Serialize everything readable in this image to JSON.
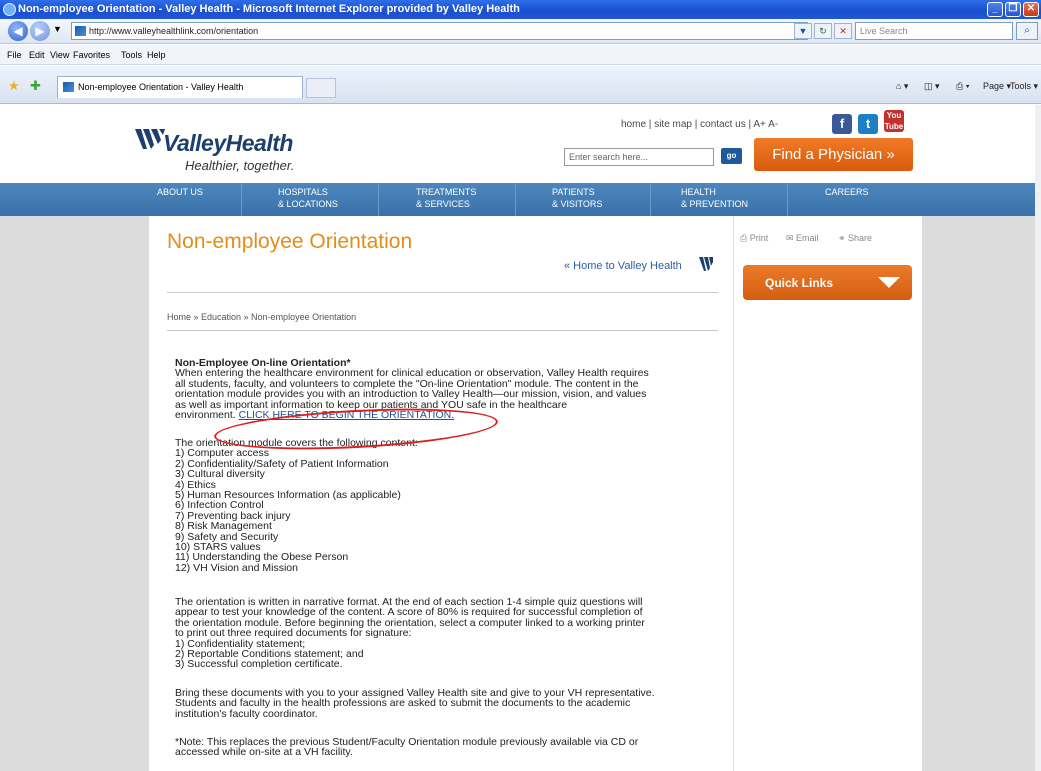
{
  "window": {
    "title": "Non-employee Orientation - Valley Health - Microsoft Internet Explorer provided by Valley Health",
    "address": "http://www.valleyhealthlink.com/orientation",
    "search_placeholder": "Live Search",
    "menu": [
      "File",
      "Edit",
      "View",
      "Favorites",
      "Tools",
      "Help"
    ],
    "tab_title": "Non-employee Orientation - Valley Health",
    "commands": [
      "Page ▾",
      "Tools ▾"
    ]
  },
  "site": {
    "logo_name": "ValleyHealth",
    "logo_tagline": "Healthier, together.",
    "top_links": [
      "home",
      "site map",
      "contact us",
      "A+",
      "A-"
    ],
    "social": [
      "facebook-icon",
      "twitter-icon",
      "youtube-icon"
    ],
    "search_placeholder": "Enter search here...",
    "go_label": "go",
    "find_physician": "Find a Physician »",
    "nav": [
      {
        "line1": "ABOUT US",
        "line2": ""
      },
      {
        "line1": "HOSPITALS",
        "line2": "& LOCATIONS"
      },
      {
        "line1": "TREATMENTS",
        "line2": "& SERVICES"
      },
      {
        "line1": "PATIENTS",
        "line2": "& VISITORS"
      },
      {
        "line1": "HEALTH",
        "line2": "& PREVENTION"
      },
      {
        "line1": "CAREERS",
        "line2": ""
      }
    ],
    "accent_color": "#e38d1a",
    "nav_color": "#3a71aa"
  },
  "page": {
    "title": "Non-employee Orientation",
    "home_link": "« Home to Valley Health",
    "breadcrumb": "Home » Education » Non-employee Orientation",
    "tools": [
      "Print",
      "Email",
      "Share"
    ],
    "quick_links": "Quick Links",
    "section_heading": "Non-Employee On-line Orientation*",
    "intro_lines": [
      "When entering the healthcare environment for clinical education or observation, Valley Health requires",
      "all students, faculty, and volunteers to complete the \"On-line Orientation\" module. The content in the",
      "orientation module provides you with an introduction to Valley Health—our mission, vision, and values",
      "as well as important information to keep our patients and YOU safe in the healthcare"
    ],
    "intro_last_prefix": "environment. ",
    "orientation_link": "CLICK HERE TO BEGIN THE ORIENTATION.",
    "covers_heading": "The orientation module covers the following content:",
    "topics": [
      "1) Computer access",
      "2) Confidentiality/Safety of Patient Information",
      "3) Cultural diversity",
      "4) Ethics",
      "5) Human Resources Information (as applicable)",
      "6) Infection Control",
      "7) Preventing back injury",
      "8) Risk Management",
      "9) Safety and Security",
      "10) STARS values",
      "11) Understanding the Obese Person",
      "12) VH Vision and Mission"
    ],
    "narrative_lines": [
      "The orientation is written in narrative format. At the end of each section 1-4 simple quiz questions will",
      "appear to test your knowledge of the content. A score of 80% is required for successful completion of",
      "the orientation module. Before beginning the orientation, select a computer linked to a working printer",
      "to print out three required documents for signature:",
      "1) Confidentiality statement;",
      "2) Reportable Conditions statement; and",
      "3) Successful completion certificate."
    ],
    "bring_lines": [
      "Bring these documents with you to your assigned Valley Health site and give to your VH representative.",
      "Students and faculty in the health professions are asked to submit the documents to the academic",
      "institution's faculty coordinator."
    ],
    "note_lines": [
      "*Note: This replaces the previous Student/Faculty Orientation module previously available via CD or",
      "accessed while on-site at a VH facility."
    ]
  }
}
